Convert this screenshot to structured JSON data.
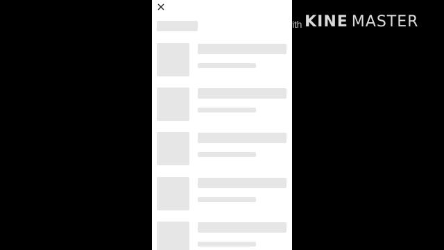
{
  "watermark": {
    "prefix": "Made with",
    "brand_bold": "KINE",
    "brand_regular": "MASTER"
  },
  "colors": {
    "background": "#000000",
    "screen": "#ffffff",
    "skeleton": "#e6e6e6",
    "close_icon": "#222222"
  },
  "icons": {
    "close": "close-icon"
  },
  "list": {
    "item_count": 5
  }
}
